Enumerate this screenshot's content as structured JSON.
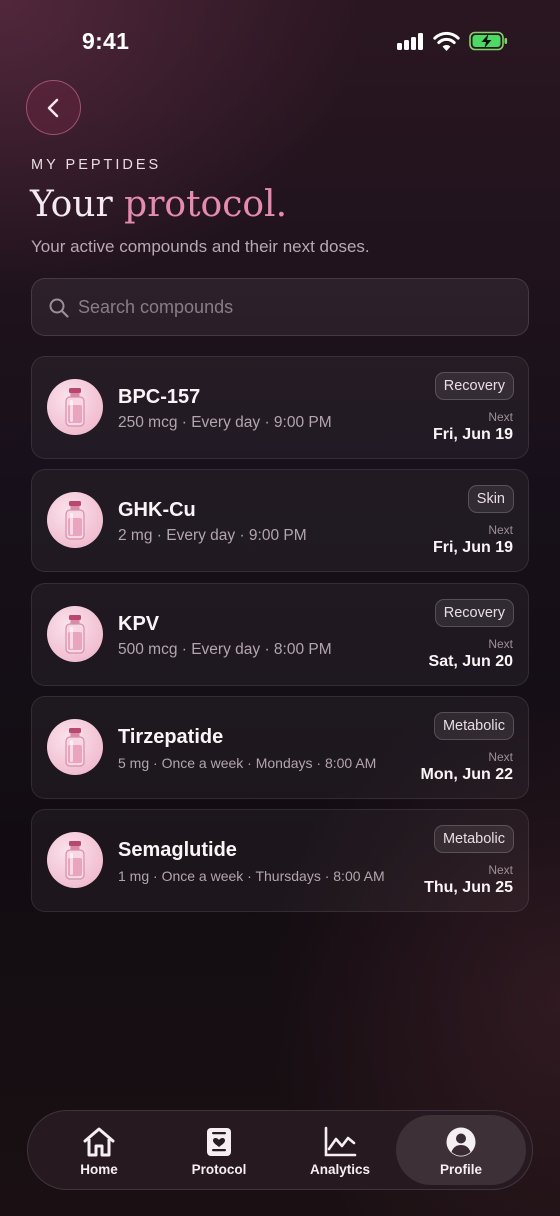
{
  "status_bar": {
    "time": "9:41"
  },
  "header": {
    "eyebrow": "MY PEPTIDES",
    "title_plain": "Your ",
    "title_accent": "protocol.",
    "subtitle": "Your active compounds and their next doses."
  },
  "search": {
    "placeholder": "Search compounds",
    "value": ""
  },
  "compounds": [
    {
      "name": "BPC-157",
      "detail": "250 mcg · Every day · 9:00 PM",
      "tag": "Recovery",
      "next_label": "Next",
      "next_date": "Fri, Jun 19"
    },
    {
      "name": "GHK-Cu",
      "detail": "2 mg · Every day · 9:00 PM",
      "tag": "Skin",
      "next_label": "Next",
      "next_date": "Fri, Jun 19"
    },
    {
      "name": "KPV",
      "detail": "500 mcg · Every day · 8:00 PM",
      "tag": "Recovery",
      "next_label": "Next",
      "next_date": "Sat, Jun 20"
    },
    {
      "name": "Tirzepatide",
      "detail": "5 mg · Once a week · Mondays · 8:00 AM",
      "tag": "Metabolic",
      "next_label": "Next",
      "next_date": "Mon, Jun 22"
    },
    {
      "name": "Semaglutide",
      "detail": "1 mg · Once a week · Thursdays · 8:00 AM",
      "tag": "Metabolic",
      "next_label": "Next",
      "next_date": "Thu, Jun 25"
    }
  ],
  "tabbar": {
    "items": [
      {
        "label": "Home",
        "icon": "home-icon"
      },
      {
        "label": "Protocol",
        "icon": "protocol-icon"
      },
      {
        "label": "Analytics",
        "icon": "analytics-icon"
      },
      {
        "label": "Profile",
        "icon": "profile-icon"
      }
    ],
    "active": "Profile"
  },
  "colors": {
    "accent": "#e58bb0",
    "vial": "#f1bfd1"
  }
}
